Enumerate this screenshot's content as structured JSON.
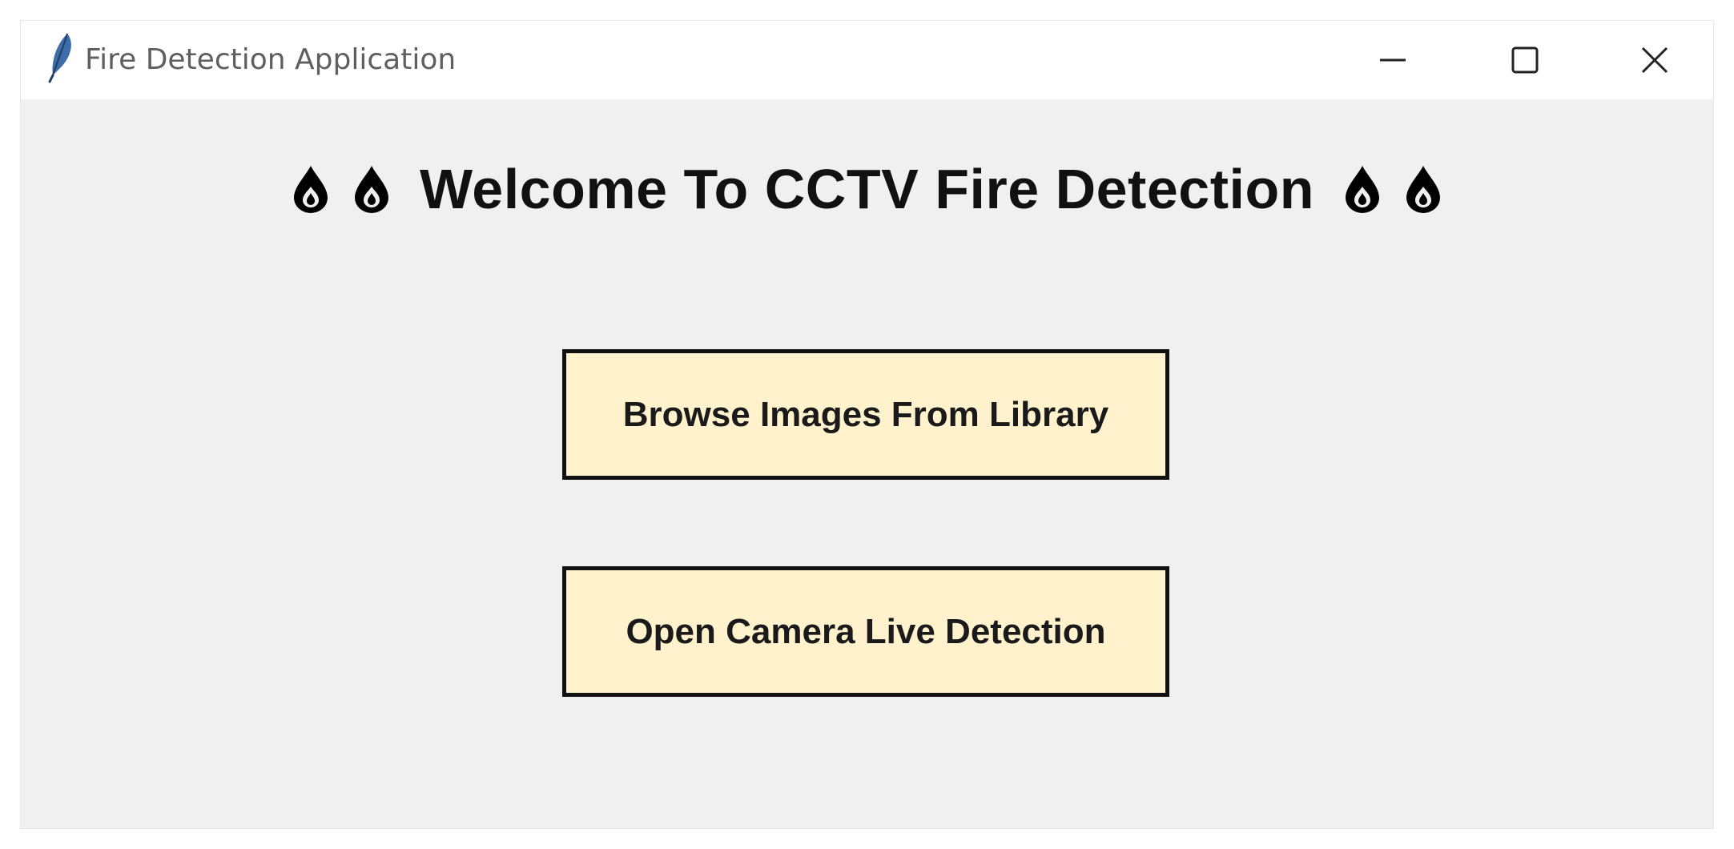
{
  "window": {
    "title": "Fire Detection Application",
    "icon": "feather-icon",
    "controls": {
      "minimize_icon": "minimize-icon",
      "maximize_icon": "maximize-icon",
      "close_icon": "close-icon"
    }
  },
  "main": {
    "heading": "Welcome To CCTV Fire Detection",
    "heading_icon": "flame-drop-icon",
    "buttons": {
      "browse_label": "Browse Images From Library",
      "camera_label": "Open Camera Live Detection"
    }
  },
  "colors": {
    "window_background": "#f0f0f0",
    "titlebar_background": "#ffffff",
    "button_background": "#fff2cc",
    "button_border": "#111111",
    "heading_text": "#111111"
  }
}
